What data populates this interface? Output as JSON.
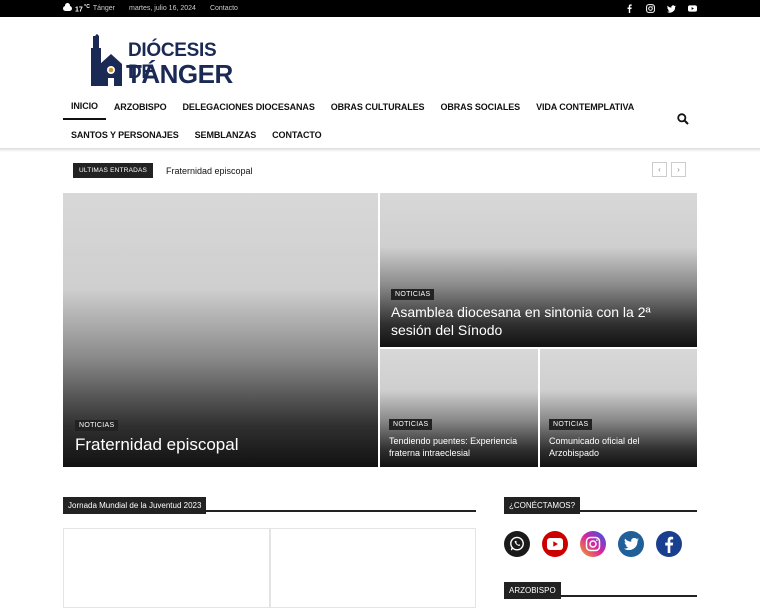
{
  "topbar": {
    "temperature": "17",
    "temp_unit": "C",
    "city": "Tánger",
    "date": "martes, julio 16, 2024",
    "contact_link": "Contacto",
    "social_icons": [
      "facebook-icon",
      "instagram-icon",
      "twitter-icon",
      "youtube-icon"
    ]
  },
  "logo": {
    "line1": "DIÓCESIS DE",
    "line2": "TÁNGER"
  },
  "nav": {
    "row1": [
      "INICIO",
      "ARZOBISPO",
      "DELEGACIONES DIOCESANAS",
      "OBRAS CULTURALES",
      "OBRAS SOCIALES",
      "VIDA CONTEMPLATIVA"
    ],
    "row2": [
      "SANTOS Y PERSONAJES",
      "SEMBLANZAS",
      "CONTACTO"
    ],
    "active": "INICIO"
  },
  "ticker": {
    "label": "ULTIMAS ENTRADAS",
    "headline": "Fraternidad episcopal",
    "prev": "‹",
    "next": "›"
  },
  "featured": [
    {
      "category": "NOTICIAS",
      "title": "Fraternidad episcopal"
    },
    {
      "category": "NOTICIAS",
      "title": "Asamblea diocesana en sintonia con la 2ª sesión del Sínodo"
    },
    {
      "category": "NOTICIAS",
      "title": "Tendiendo puentes: Experiencia fraterna intraeclesial"
    },
    {
      "category": "NOTICIAS",
      "title": "Comunicado oficial del Arzobispado"
    }
  ],
  "sections": {
    "jmj": "Jornada Mundial de la Juventud 2023",
    "connect": "¿CONÉCTAMOS?",
    "arzobispo": "ARZOBISPO"
  },
  "colors": {
    "brand": "#1b2a55",
    "dark": "#222222",
    "whatsapp": "#1a1a1a",
    "youtube": "#cc0000",
    "instagram": "#c13584",
    "twitter": "#1f5f9a",
    "facebook": "#1b3f8f"
  }
}
